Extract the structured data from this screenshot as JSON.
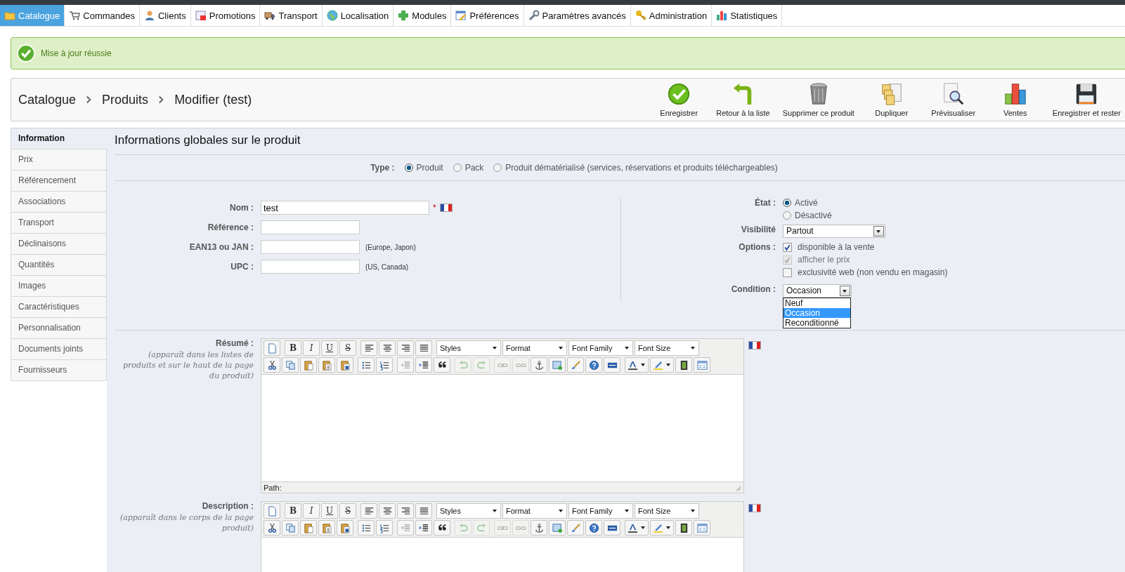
{
  "top_nav": [
    {
      "label": "Catalogue",
      "kind": "folder",
      "selected": true
    },
    {
      "label": "Commandes",
      "kind": "cart",
      "selected": false
    },
    {
      "label": "Clients",
      "kind": "person",
      "selected": false
    },
    {
      "label": "Promotions",
      "kind": "promo",
      "selected": false
    },
    {
      "label": "Transport",
      "kind": "truck",
      "selected": false
    },
    {
      "label": "Localisation",
      "kind": "globe",
      "selected": false
    },
    {
      "label": "Modules",
      "kind": "puzzle",
      "selected": false
    },
    {
      "label": "Préférences",
      "kind": "prefs",
      "selected": false
    },
    {
      "label": "Paramètres avancés",
      "kind": "wrench",
      "selected": false
    },
    {
      "label": "Administration",
      "kind": "key",
      "selected": false
    },
    {
      "label": "Statistiques",
      "kind": "chart",
      "selected": false
    }
  ],
  "alert": {
    "message": "Mise à jour réussie"
  },
  "breadcrumb": [
    "Catalogue",
    "Produits",
    "Modifier (test)"
  ],
  "actions": [
    {
      "label": "Enregistrer",
      "kind": "check"
    },
    {
      "label": "Retour à la liste",
      "kind": "back"
    },
    {
      "label": "Supprimer ce produit",
      "kind": "trash"
    },
    {
      "label": "Dupliquer",
      "kind": "copies"
    },
    {
      "label": "Prévisualiser",
      "kind": "preview"
    },
    {
      "label": "Ventes",
      "kind": "sales"
    },
    {
      "label": "Enregistrer et rester",
      "kind": "floppy"
    }
  ],
  "tabs": [
    {
      "label": "Information",
      "selected": true
    },
    {
      "label": "Prix",
      "selected": false
    },
    {
      "label": "Référencement",
      "selected": false
    },
    {
      "label": "Associations",
      "selected": false
    },
    {
      "label": "Transport",
      "selected": false
    },
    {
      "label": "Déclinaisons",
      "selected": false
    },
    {
      "label": "Quantités",
      "selected": false
    },
    {
      "label": "Images",
      "selected": false
    },
    {
      "label": "Caractéristiques",
      "selected": false
    },
    {
      "label": "Personnalisation",
      "selected": false
    },
    {
      "label": "Documents joints",
      "selected": false
    },
    {
      "label": "Fournisseurs",
      "selected": false
    }
  ],
  "section_title": "Informations globales sur le produit",
  "type": {
    "label": "Type :",
    "options": [
      {
        "label": "Produit",
        "selected": true
      },
      {
        "label": "Pack",
        "selected": false
      },
      {
        "label": "Produit dématérialisé (services, réservations et produits téléchargeables)",
        "selected": false
      }
    ]
  },
  "fields": [
    {
      "label": "Nom :",
      "value": "test",
      "kind": "multilang",
      "required_mark": "*"
    },
    {
      "label": "Référence :",
      "kind": "short"
    },
    {
      "label": "EAN13 ou JAN :",
      "kind": "short",
      "hint": "(Europe, Japon)"
    },
    {
      "label": "UPC :",
      "kind": "short",
      "hint": "(US, Canada)"
    }
  ],
  "status": {
    "label": "État :",
    "options": [
      {
        "label": "Activé",
        "selected": true
      },
      {
        "label": "Désactivé",
        "selected": false
      }
    ]
  },
  "visibility": {
    "label": "Visibilité",
    "value": "Partout"
  },
  "options": {
    "label": "Options :",
    "items": [
      {
        "label": "disponible à la vente",
        "checked": true,
        "disabled": false
      },
      {
        "label": "afficher le prix",
        "checked": true,
        "disabled": true
      },
      {
        "label": "exclusivité web (non vendu en magasin)",
        "checked": false,
        "disabled": false
      }
    ]
  },
  "condition": {
    "label": "Condition :",
    "value": "Occasion",
    "expanded": true,
    "options": [
      {
        "label": "Neuf",
        "selected": false
      },
      {
        "label": "Occasion",
        "selected": true
      },
      {
        "label": "Reconditionné",
        "selected": false
      }
    ]
  },
  "editors": [
    {
      "label": "Résumé :",
      "hint": "(apparaît dans les listes de produits et sur le haut de la page du produit)",
      "status_path": "Path:",
      "toolbar": [
        [
          [
            {
              "kind": "newdocument",
              "disabled": false
            }
          ],
          [
            {
              "kind": "bold",
              "label": "B",
              "disabled": false
            },
            {
              "kind": "italic",
              "label": "I",
              "disabled": false
            },
            {
              "kind": "underline",
              "label": "U",
              "disabled": false
            },
            {
              "kind": "strike",
              "label": "S",
              "disabled": false
            }
          ],
          [
            {
              "kind": "alignleft",
              "disabled": false
            },
            {
              "kind": "aligncenter",
              "disabled": false
            },
            {
              "kind": "alignright",
              "disabled": false
            },
            {
              "kind": "alignjustify",
              "disabled": false
            }
          ],
          [
            {
              "kind": "select",
              "label": "Styles",
              "disabled": false
            },
            {
              "kind": "select",
              "label": "Format",
              "disabled": false
            },
            {
              "kind": "select",
              "label": "Font Family",
              "disabled": false
            },
            {
              "kind": "select",
              "label": "Font Size",
              "disabled": false
            }
          ]
        ],
        [
          [
            {
              "kind": "cut",
              "disabled": false
            },
            {
              "kind": "copy",
              "disabled": false
            },
            {
              "kind": "paste",
              "disabled": false
            },
            {
              "kind": "pastetext",
              "disabled": false
            },
            {
              "kind": "pasteword",
              "disabled": false
            }
          ],
          [
            {
              "kind": "bulletlist",
              "disabled": false
            },
            {
              "kind": "numberedlist",
              "disabled": false
            }
          ],
          [
            {
              "kind": "outdent",
              "disabled": false
            },
            {
              "kind": "indent",
              "disabled": false
            },
            {
              "kind": "quote",
              "disabled": false
            }
          ],
          [
            {
              "kind": "undo",
              "disabled": true
            },
            {
              "kind": "redo",
              "disabled": true
            }
          ],
          [
            {
              "kind": "link",
              "disabled": true
            },
            {
              "kind": "unlink",
              "disabled": true
            },
            {
              "kind": "anchor",
              "disabled": false
            },
            {
              "kind": "image",
              "disabled": false
            },
            {
              "kind": "brush",
              "disabled": false
            },
            {
              "kind": "help",
              "disabled": false
            },
            {
              "kind": "html",
              "disabled": false
            }
          ],
          [
            {
              "kind": "textcolor",
              "disabled": false
            },
            {
              "kind": "highlight",
              "disabled": false
            },
            {
              "kind": "film",
              "disabled": false
            },
            {
              "kind": "template",
              "disabled": false
            }
          ]
        ]
      ]
    },
    {
      "label": "Description :",
      "hint": "(apparaît dans le corps de la page produit)",
      "toolbar": [
        [
          [
            {
              "kind": "newdocument",
              "disabled": false
            }
          ],
          [
            {
              "kind": "bold",
              "label": "B",
              "disabled": false
            },
            {
              "kind": "italic",
              "label": "I",
              "disabled": false
            },
            {
              "kind": "underline",
              "label": "U",
              "disabled": false
            },
            {
              "kind": "strike",
              "label": "S",
              "disabled": false
            }
          ],
          [
            {
              "kind": "alignleft",
              "disabled": false
            },
            {
              "kind": "aligncenter",
              "disabled": false
            },
            {
              "kind": "alignright",
              "disabled": false
            },
            {
              "kind": "alignjustify",
              "disabled": false
            }
          ],
          [
            {
              "kind": "select",
              "label": "Styles",
              "disabled": false
            },
            {
              "kind": "select",
              "label": "Format",
              "disabled": false
            },
            {
              "kind": "select",
              "label": "Font Family",
              "disabled": false
            },
            {
              "kind": "select",
              "label": "Font Size",
              "disabled": false
            }
          ]
        ],
        [
          [
            {
              "kind": "cut",
              "disabled": false
            },
            {
              "kind": "copy",
              "disabled": false
            },
            {
              "kind": "paste",
              "disabled": false
            },
            {
              "kind": "pastetext",
              "disabled": false
            },
            {
              "kind": "pasteword",
              "disabled": false
            }
          ],
          [
            {
              "kind": "bulletlist",
              "disabled": false
            },
            {
              "kind": "numberedlist",
              "disabled": false
            }
          ],
          [
            {
              "kind": "outdent",
              "disabled": false
            },
            {
              "kind": "indent",
              "disabled": false
            },
            {
              "kind": "quote",
              "disabled": false
            }
          ],
          [
            {
              "kind": "undo",
              "disabled": true
            },
            {
              "kind": "redo",
              "disabled": true
            }
          ],
          [
            {
              "kind": "link",
              "disabled": true
            },
            {
              "kind": "unlink",
              "disabled": true
            },
            {
              "kind": "anchor",
              "disabled": false
            },
            {
              "kind": "image",
              "disabled": false
            },
            {
              "kind": "brush",
              "disabled": false
            },
            {
              "kind": "help",
              "disabled": false
            },
            {
              "kind": "html",
              "disabled": false
            }
          ],
          [
            {
              "kind": "textcolor",
              "disabled": false
            },
            {
              "kind": "highlight",
              "disabled": false
            },
            {
              "kind": "film",
              "disabled": false
            },
            {
              "kind": "template",
              "disabled": false
            }
          ]
        ]
      ]
    }
  ]
}
